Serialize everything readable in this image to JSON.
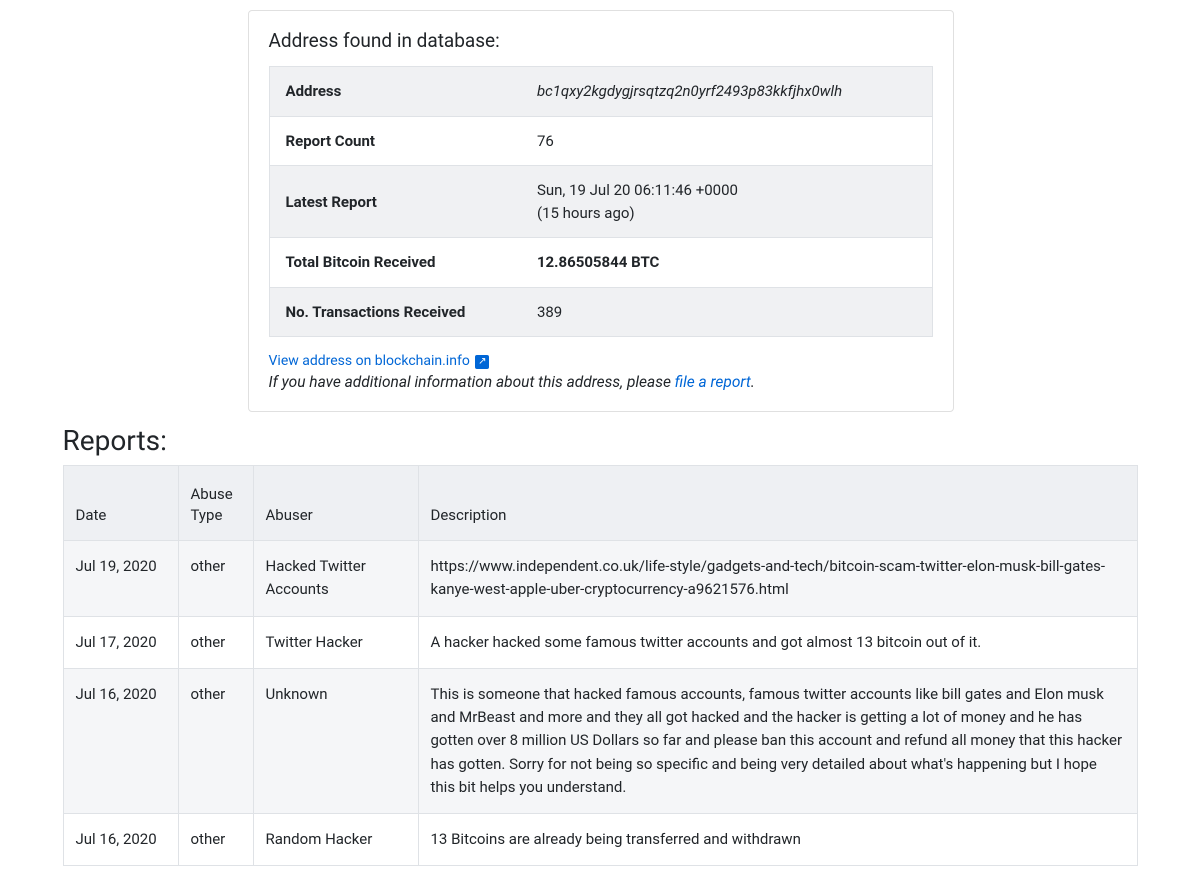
{
  "card": {
    "title": "Address found in database:",
    "rows": {
      "address_label": "Address",
      "address_value": "bc1qxy2kgdygjrsqtzq2n0yrf2493p83kkfjhx0wlh",
      "report_count_label": "Report Count",
      "report_count_value": "76",
      "latest_report_label": "Latest Report",
      "latest_report_value": "Sun, 19 Jul 20 06:11:46 +0000",
      "latest_report_relative": "(15 hours ago)",
      "total_btc_label": "Total Bitcoin Received",
      "total_btc_value": "12.86505844 BTC",
      "tx_count_label": "No. Transactions Received",
      "tx_count_value": "389"
    },
    "blockchain_link": "View address on blockchain.info",
    "info_prefix": "If you have additional information about this address, please ",
    "info_link": "file a report",
    "info_suffix": "."
  },
  "reports": {
    "heading": "Reports:",
    "columns": {
      "date": "Date",
      "abuse_type_line1": "Abuse",
      "abuse_type_line2": "Type",
      "abuser": "Abuser",
      "description": "Description"
    },
    "rows": [
      {
        "date": "Jul 19, 2020",
        "type": "other",
        "abuser": "Hacked Twitter Accounts",
        "description": "https://www.independent.co.uk/life-style/gadgets-and-tech/bitcoin-scam-twitter-elon-musk-bill-gates-kanye-west-apple-uber-cryptocurrency-a9621576.html"
      },
      {
        "date": "Jul 17, 2020",
        "type": "other",
        "abuser": "Twitter Hacker",
        "description": "A hacker hacked some famous twitter accounts and got almost 13 bitcoin out of it."
      },
      {
        "date": "Jul 16, 2020",
        "type": "other",
        "abuser": "Unknown",
        "description": "This is someone that hacked famous accounts, famous twitter accounts like bill gates and Elon musk and MrBeast and more and they all got hacked and the hacker is getting a lot of money and he has gotten over 8 million US Dollars so far and please ban this account and refund all money that this hacker has gotten. Sorry for not being so specific and being very detailed about what's happening but I hope this bit helps you understand."
      },
      {
        "date": "Jul 16, 2020",
        "type": "other",
        "abuser": "Random Hacker",
        "description": "13 Bitcoins are already being transferred and withdrawn"
      }
    ]
  }
}
